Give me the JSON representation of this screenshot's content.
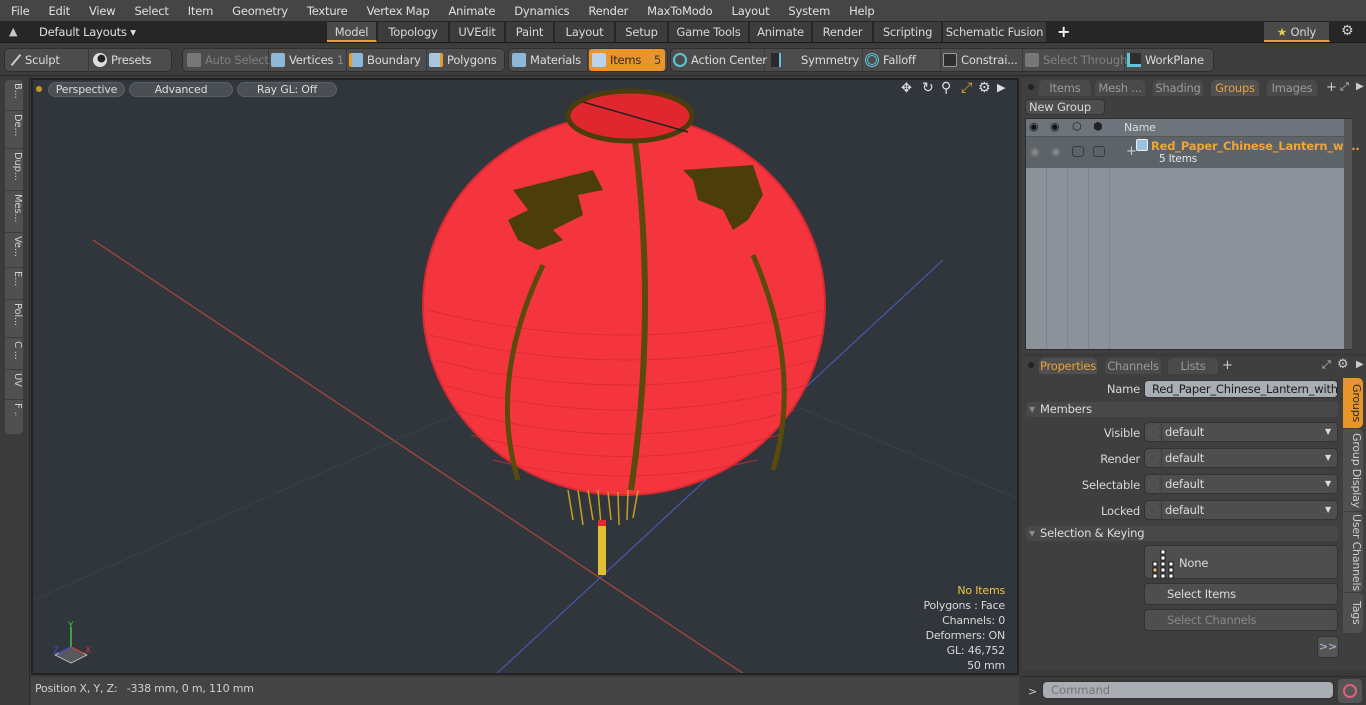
{
  "menubar": {
    "items": [
      "File",
      "Edit",
      "View",
      "Select",
      "Item",
      "Geometry",
      "Texture",
      "Vertex Map",
      "Animate",
      "Dynamics",
      "Render",
      "MaxToModo",
      "Layout",
      "System",
      "Help"
    ]
  },
  "layouts": {
    "dropdown_label": "Default Layouts",
    "tabs": [
      "Model",
      "Topology",
      "UVEdit",
      "Paint",
      "Layout",
      "Setup",
      "Game Tools",
      "Animate",
      "Render",
      "Scripting",
      "Schematic Fusion"
    ],
    "active_tab": "Model",
    "add_label": "+",
    "only_label": "Only"
  },
  "toolbar": {
    "sculpt": "Sculpt",
    "presets": "Presets",
    "auto_select": "Auto Select",
    "vertices": "Vertices",
    "vertices_count": "1",
    "boundary": "Boundary",
    "polygons": "Polygons",
    "materials": "Materials",
    "items": "Items",
    "items_count": "5",
    "action_center": "Action Center",
    "symmetry": "Symmetry",
    "falloff": "Falloff",
    "constraints": "Constrai...",
    "select_through": "Select Through",
    "workplane": "WorkPlane"
  },
  "left_tabs": [
    "B...",
    "De...",
    "Dup...",
    "Mes...",
    "Ve...",
    "E...",
    "Pol...",
    "C ...",
    "UV",
    "F ..."
  ],
  "viewport": {
    "view_mode": "Perspective",
    "shading": "Advanced",
    "raygl": "Ray GL: Off",
    "info": {
      "selection": "No Items",
      "polygons": "Polygons : Face",
      "channels": "Channels: 0",
      "deformers": "Deformers: ON",
      "gl": "GL: 46,752",
      "grid": "50 mm"
    },
    "axis_labels": {
      "x": "X",
      "y": "Y",
      "z": "Z"
    }
  },
  "status": {
    "position_label": "Position X, Y, Z:",
    "position_value": "-338 mm, 0 m, 110 mm"
  },
  "groups_panel": {
    "tabs": [
      "Items",
      "Mesh ...",
      "Shading",
      "Groups",
      "Images"
    ],
    "active_tab": "Groups",
    "new_group": "New Group",
    "column_name": "Name",
    "rows": [
      {
        "name": "Red_Paper_Chinese_Lantern_wi...",
        "sub": "5 Items"
      }
    ]
  },
  "properties_panel": {
    "tabs": [
      "Properties",
      "Channels",
      "Lists"
    ],
    "active_tab": "Properties",
    "name_label": "Name",
    "name_value": "Red_Paper_Chinese_Lantern_with_Ta",
    "members_section": "Members",
    "fields": [
      {
        "label": "Visible",
        "value": "default"
      },
      {
        "label": "Render",
        "value": "default"
      },
      {
        "label": "Selectable",
        "value": "default"
      },
      {
        "label": "Locked",
        "value": "default"
      }
    ],
    "selection_section": "Selection & Keying",
    "none_label": "None",
    "select_items": "Select Items",
    "select_channels": "Select Channels",
    "more": ">>",
    "side_tabs": [
      "Groups",
      "Group Display",
      "User Channels",
      "Tags"
    ]
  },
  "command": {
    "prompt": ">",
    "placeholder": "Command"
  },
  "colors": {
    "accent": "#e8952a",
    "lantern_red": "#f5353d",
    "lantern_trim": "#4b3d0c"
  }
}
